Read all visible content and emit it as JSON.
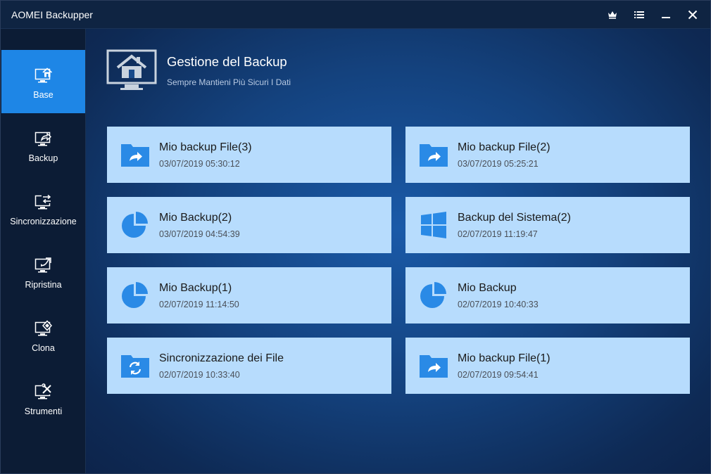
{
  "window": {
    "title": "AOMEI Backupper",
    "controls": [
      {
        "name": "upgrade-crown-icon"
      },
      {
        "name": "menu-list-icon"
      },
      {
        "name": "minimize-icon"
      },
      {
        "name": "close-icon"
      }
    ]
  },
  "sidebar": {
    "items": [
      {
        "label": "Base",
        "icon": "home-monitor-icon",
        "active": true
      },
      {
        "label": "Backup",
        "icon": "backup-monitor-icon",
        "active": false
      },
      {
        "label": "Sincronizzazione",
        "icon": "sync-monitor-icon",
        "active": false
      },
      {
        "label": "Ripristina",
        "icon": "restore-monitor-icon",
        "active": false
      },
      {
        "label": "Clona",
        "icon": "clone-monitor-icon",
        "active": false
      },
      {
        "label": "Strumenti",
        "icon": "tools-monitor-icon",
        "active": false
      }
    ]
  },
  "main": {
    "title": "Gestione del Backup",
    "subtitle": "Sempre Mantieni Più Sicuri I Dati",
    "cards": [
      {
        "title": "Mio backup File(3)",
        "date": "03/07/2019 05:30:12",
        "icon": "folder-share-icon"
      },
      {
        "title": "Mio backup File(2)",
        "date": "03/07/2019 05:25:21",
        "icon": "folder-share-icon"
      },
      {
        "title": "Mio Backup(2)",
        "date": "03/07/2019 04:54:39",
        "icon": "partition-pie-icon"
      },
      {
        "title": "Backup del Sistema(2)",
        "date": "02/07/2019 11:19:47",
        "icon": "windows-icon"
      },
      {
        "title": "Mio Backup(1)",
        "date": "02/07/2019 11:14:50",
        "icon": "partition-pie-icon"
      },
      {
        "title": "Mio Backup",
        "date": "02/07/2019 10:40:33",
        "icon": "partition-pie-icon"
      },
      {
        "title": "Sincronizzazione dei File",
        "date": "02/07/2019 10:33:40",
        "icon": "folder-sync-icon"
      },
      {
        "title": "Mio backup File(1)",
        "date": "02/07/2019 09:54:41",
        "icon": "folder-share-icon"
      }
    ]
  },
  "colors": {
    "accent": "#1e86e6",
    "card_bg": "#b7dcfd",
    "icon_blue": "#2a8ae6"
  }
}
